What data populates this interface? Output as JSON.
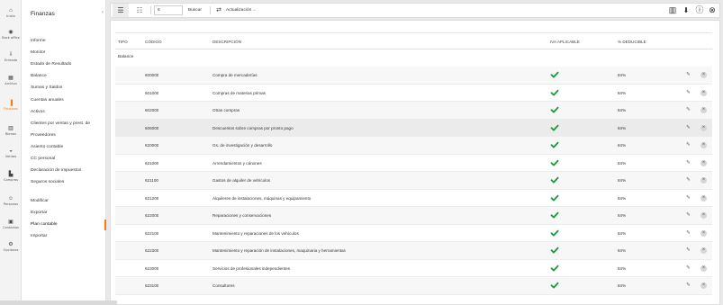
{
  "rail": [
    {
      "icon": "⌂",
      "label": "Inicio",
      "icon_name": "home-icon"
    },
    {
      "icon": "◉",
      "label": "Back office",
      "icon_name": "backoffice-icon"
    },
    {
      "icon": "⇩",
      "label": "Entrada",
      "icon_name": "inbox-icon"
    },
    {
      "icon": "▦",
      "label": "Archivo",
      "icon_name": "archive-icon"
    },
    {
      "icon": "▐",
      "label": "Finanzas",
      "icon_name": "finance-icon"
    },
    {
      "icon": "▥",
      "label": "Bienes",
      "icon_name": "assets-icon"
    },
    {
      "icon": "◒",
      "label": "Ventas",
      "icon_name": "sales-icon"
    },
    {
      "icon": "▙",
      "label": "Compras",
      "icon_name": "purchases-icon"
    },
    {
      "icon": "☺",
      "label": "Personas",
      "icon_name": "people-icon"
    },
    {
      "icon": "▣",
      "label": "Contactos",
      "icon_name": "contacts-icon"
    },
    {
      "icon": "⚙",
      "label": "Opciones",
      "icon_name": "options-icon"
    }
  ],
  "sidebar": {
    "title": "Finanzas",
    "collapse_icon": "‹",
    "items": [
      {
        "label": "Informe"
      },
      {
        "label": "Monitor"
      },
      {
        "label": "Estado de Resultado"
      },
      {
        "label": "Balance"
      },
      {
        "label": "Sumas y Saldos"
      },
      {
        "label": "Cuentas anuales"
      },
      {
        "label": "Activos"
      },
      {
        "label": "Clientes por ventas y prest. de"
      },
      {
        "label": "Proveedores"
      },
      {
        "label": "Asiento contable"
      },
      {
        "label": "CC personal"
      },
      {
        "label": "Declaración de impuestos"
      },
      {
        "label": "Seguros sociales"
      },
      {
        "label": "Modificar"
      },
      {
        "label": "Exportar"
      },
      {
        "label": "Plan contable"
      },
      {
        "label": "Importar"
      }
    ]
  },
  "toolbar": {
    "list_view_icon": "☰",
    "detail_view_icon": "☷",
    "search_value": "6",
    "search_label": "Buscar",
    "refresh_icon": "⇄",
    "refresh_label": "Actualización ...",
    "barcode_icon": "▥",
    "download_icon": "⬇",
    "info_icon": "ⓘ",
    "close_icon": "⊗"
  },
  "table": {
    "headers": {
      "tipo": "TIPO",
      "codigo": "CÓDIGO",
      "descripcion": "DESCRIPCIÓN",
      "iva": "IVA APLICABLE",
      "deducible": "% DEDUCIBLE"
    },
    "group_label": "Balance",
    "edit_icon": "✎",
    "delete_icon": "×",
    "accent_check": "#1a9a3a",
    "rows": [
      {
        "codigo": "600000",
        "descripcion": "Compra de mercaderías",
        "deducible": "84%"
      },
      {
        "codigo": "601000",
        "descripcion": "Compras de materias primas",
        "deducible": "84%"
      },
      {
        "codigo": "602000",
        "descripcion": "Otras compras",
        "deducible": "84%"
      },
      {
        "codigo": "606000",
        "descripcion": "Descuentos sobre compras por pronto pago",
        "deducible": "84%"
      },
      {
        "codigo": "620000",
        "descripcion": "Gs. de investigación y desarrollo",
        "deducible": "84%"
      },
      {
        "codigo": "621000",
        "descripcion": "Arrendamientos y cánones",
        "deducible": "84%"
      },
      {
        "codigo": "621100",
        "descripcion": "Gastos de alquiler de vehículos",
        "deducible": "84%"
      },
      {
        "codigo": "621200",
        "descripcion": "Alquileres de instalaciones, máquinas y equipamiento",
        "deducible": "84%"
      },
      {
        "codigo": "622000",
        "descripcion": "Reparaciones y conservaciones",
        "deducible": "84%"
      },
      {
        "codigo": "622100",
        "descripcion": "Mantenimiento y reparaciones de los vehículos",
        "deducible": "84%"
      },
      {
        "codigo": "622300",
        "descripcion": "Mantenimiento y reparación de instalaciones, maquinaria y herramientas",
        "deducible": "84%"
      },
      {
        "codigo": "623000",
        "descripcion": "Servicios de profesionales independientes",
        "deducible": "84%"
      },
      {
        "codigo": "623100",
        "descripcion": "Consultores",
        "deducible": "84%"
      }
    ]
  }
}
